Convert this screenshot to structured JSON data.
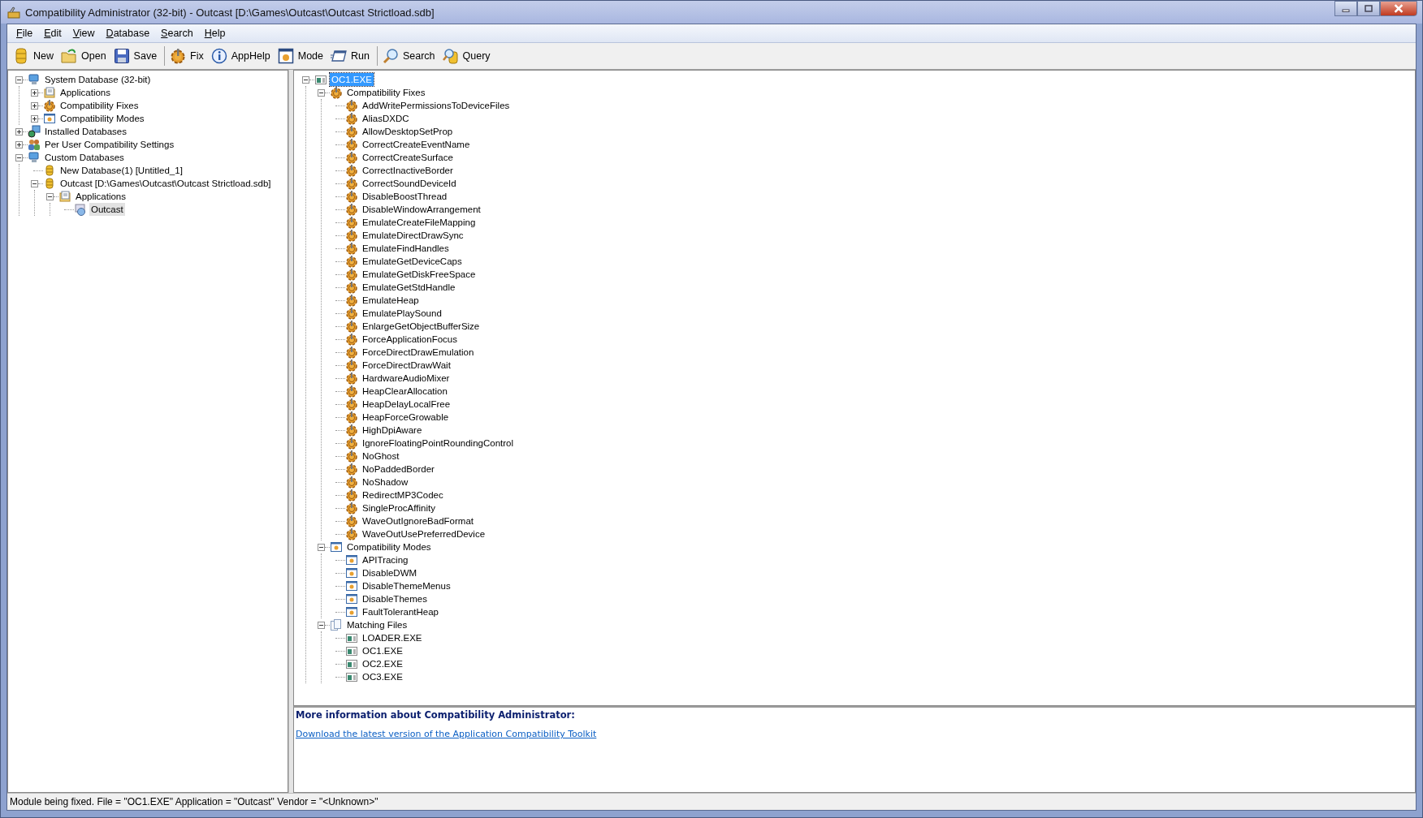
{
  "window": {
    "title": "Compatibility Administrator (32-bit) - Outcast [D:\\Games\\Outcast\\Outcast Strictload.sdb]"
  },
  "menu": [
    "File",
    "Edit",
    "View",
    "Database",
    "Search",
    "Help"
  ],
  "toolbar": [
    [
      {
        "label": "New",
        "kind": "new"
      },
      {
        "label": "Open",
        "kind": "open"
      },
      {
        "label": "Save",
        "kind": "save"
      }
    ],
    [
      {
        "label": "Fix",
        "kind": "fix"
      },
      {
        "label": "AppHelp",
        "kind": "apphelp"
      },
      {
        "label": "Mode",
        "kind": "mode"
      },
      {
        "label": "Run",
        "kind": "run"
      }
    ],
    [
      {
        "label": "Search",
        "kind": "search"
      },
      {
        "label": "Query",
        "kind": "query"
      }
    ]
  ],
  "left_tree": [
    {
      "label": "System Database (32-bit)",
      "kind": "computer",
      "expanded": true,
      "selected": false,
      "children": [
        {
          "label": "Applications",
          "kind": "apps",
          "expanded": false,
          "selected": false
        },
        {
          "label": "Compatibility Fixes",
          "kind": "fix",
          "expanded": false,
          "selected": false
        },
        {
          "label": "Compatibility Modes",
          "kind": "mode",
          "expanded": false,
          "selected": false
        }
      ]
    },
    {
      "label": "Installed Databases",
      "kind": "installed",
      "expanded": false,
      "selected": false
    },
    {
      "label": "Per User Compatibility Settings",
      "kind": "users",
      "expanded": false,
      "selected": false
    },
    {
      "label": "Custom Databases",
      "kind": "computer",
      "expanded": true,
      "selected": false,
      "children": [
        {
          "label": "New Database(1) [Untitled_1]",
          "kind": "database",
          "selected": false
        },
        {
          "label": "Outcast [D:\\Games\\Outcast\\Outcast Strictload.sdb]",
          "kind": "database",
          "expanded": true,
          "selected": false,
          "children": [
            {
              "label": "Applications",
              "kind": "apps",
              "expanded": true,
              "selected": false,
              "children": [
                {
                  "label": "Outcast",
                  "kind": "app",
                  "selected": true
                }
              ]
            }
          ]
        }
      ]
    }
  ],
  "right_tree": [
    {
      "label": "OC1.EXE",
      "kind": "exe",
      "expanded": true,
      "selected": true,
      "children": [
        {
          "label": "Compatibility Fixes",
          "kind": "fix",
          "expanded": true,
          "selected": false,
          "children": [
            {
              "label": "AddWritePermissionsToDeviceFiles",
              "kind": "fix",
              "selected": false
            },
            {
              "label": "AliasDXDC",
              "kind": "fix",
              "selected": false
            },
            {
              "label": "AllowDesktopSetProp",
              "kind": "fix",
              "selected": false
            },
            {
              "label": "CorrectCreateEventName",
              "kind": "fix",
              "selected": false
            },
            {
              "label": "CorrectCreateSurface",
              "kind": "fix",
              "selected": false
            },
            {
              "label": "CorrectInactiveBorder",
              "kind": "fix",
              "selected": false
            },
            {
              "label": "CorrectSoundDeviceId",
              "kind": "fix",
              "selected": false
            },
            {
              "label": "DisableBoostThread",
              "kind": "fix",
              "selected": false
            },
            {
              "label": "DisableWindowArrangement",
              "kind": "fix",
              "selected": false
            },
            {
              "label": "EmulateCreateFileMapping",
              "kind": "fix",
              "selected": false
            },
            {
              "label": "EmulateDirectDrawSync",
              "kind": "fix",
              "selected": false
            },
            {
              "label": "EmulateFindHandles",
              "kind": "fix",
              "selected": false
            },
            {
              "label": "EmulateGetDeviceCaps",
              "kind": "fix",
              "selected": false
            },
            {
              "label": "EmulateGetDiskFreeSpace",
              "kind": "fix",
              "selected": false
            },
            {
              "label": "EmulateGetStdHandle",
              "kind": "fix",
              "selected": false
            },
            {
              "label": "EmulateHeap",
              "kind": "fix",
              "selected": false
            },
            {
              "label": "EmulatePlaySound",
              "kind": "fix",
              "selected": false
            },
            {
              "label": "EnlargeGetObjectBufferSize",
              "kind": "fix",
              "selected": false
            },
            {
              "label": "ForceApplicationFocus",
              "kind": "fix",
              "selected": false
            },
            {
              "label": "ForceDirectDrawEmulation",
              "kind": "fix",
              "selected": false
            },
            {
              "label": "ForceDirectDrawWait",
              "kind": "fix",
              "selected": false
            },
            {
              "label": "HardwareAudioMixer",
              "kind": "fix",
              "selected": false
            },
            {
              "label": "HeapClearAllocation",
              "kind": "fix",
              "selected": false
            },
            {
              "label": "HeapDelayLocalFree",
              "kind": "fix",
              "selected": false
            },
            {
              "label": "HeapForceGrowable",
              "kind": "fix",
              "selected": false
            },
            {
              "label": "HighDpiAware",
              "kind": "fix",
              "selected": false
            },
            {
              "label": "IgnoreFloatingPointRoundingControl",
              "kind": "fix",
              "selected": false
            },
            {
              "label": "NoGhost",
              "kind": "fix",
              "selected": false
            },
            {
              "label": "NoPaddedBorder",
              "kind": "fix",
              "selected": false
            },
            {
              "label": "NoShadow",
              "kind": "fix",
              "selected": false
            },
            {
              "label": "RedirectMP3Codec",
              "kind": "fix",
              "selected": false
            },
            {
              "label": "SingleProcAffinity",
              "kind": "fix",
              "selected": false
            },
            {
              "label": "WaveOutIgnoreBadFormat",
              "kind": "fix",
              "selected": false
            },
            {
              "label": "WaveOutUsePreferredDevice",
              "kind": "fix",
              "selected": false
            }
          ]
        },
        {
          "label": "Compatibility Modes",
          "kind": "mode",
          "expanded": true,
          "selected": false,
          "children": [
            {
              "label": "APITracing",
              "kind": "mode",
              "selected": false
            },
            {
              "label": "DisableDWM",
              "kind": "mode",
              "selected": false
            },
            {
              "label": "DisableThemeMenus",
              "kind": "mode",
              "selected": false
            },
            {
              "label": "DisableThemes",
              "kind": "mode",
              "selected": false
            },
            {
              "label": "FaultTolerantHeap",
              "kind": "mode",
              "selected": false
            }
          ]
        },
        {
          "label": "Matching Files",
          "kind": "files",
          "expanded": true,
          "selected": false,
          "children": [
            {
              "label": "LOADER.EXE",
              "kind": "exe",
              "selected": false
            },
            {
              "label": "OC1.EXE",
              "kind": "exe",
              "selected": false
            },
            {
              "label": "OC2.EXE",
              "kind": "exe",
              "selected": false
            },
            {
              "label": "OC3.EXE",
              "kind": "exe",
              "selected": false
            }
          ]
        }
      ]
    }
  ],
  "info": {
    "heading": "More information about Compatibility Administrator:",
    "link": "Download the latest version of the Application Compatibility Toolkit"
  },
  "status_bar": "Module being fixed. File  = \"OC1.EXE\" Application = \"Outcast\" Vendor = \"<Unknown>\""
}
